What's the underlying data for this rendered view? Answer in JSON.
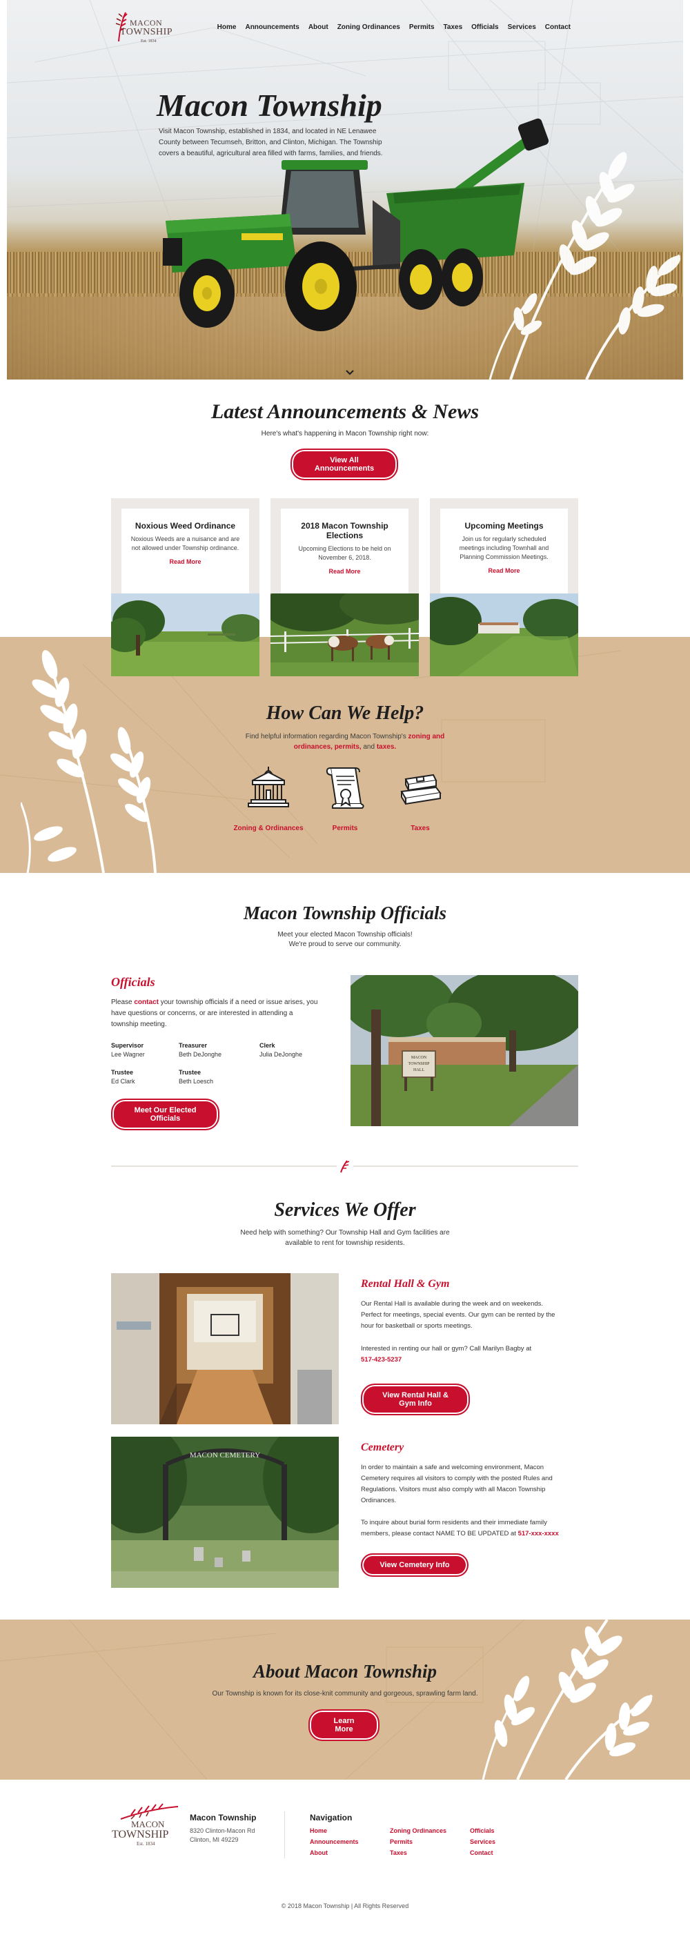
{
  "header": {
    "logo": {
      "line1": "MACON",
      "line2": "TOWNSHIP",
      "est": "Est. 1834"
    },
    "nav": [
      "Home",
      "Announcements",
      "About",
      "Zoning Ordinances",
      "Permits",
      "Taxes",
      "Officials",
      "Services",
      "Contact"
    ]
  },
  "hero": {
    "title": "Macon Township",
    "text": "Visit Macon Township, established in 1834, and located in NE Lenawee County between Tecumseh, Britton, and Clinton, Michigan. The Township covers a beautiful, agricultural area filled with farms, families, and friends."
  },
  "announcements": {
    "title": "Latest Announcements & News",
    "subtitle": "Here's what's happening in Macon Township right now:",
    "button": "View All Announcements",
    "cards": [
      {
        "title": "Noxious Weed Ordinance",
        "text": "Noxious Weeds are a nuisance and are not allowed under Township ordinance.",
        "link": "Read More"
      },
      {
        "title": "2018 Macon Township Elections",
        "text": "Upcoming Elections to be held on November 6, 2018.",
        "link": "Read More"
      },
      {
        "title": "Upcoming Meetings",
        "text": "Join us for regularly scheduled meetings including Townhall and Planning Commission Meetings.",
        "link": "Read More"
      }
    ]
  },
  "help": {
    "title": "How Can We Help?",
    "text_prefix": "Find helpful information regarding Macon Township's",
    "text_links": "zoning and ordinances, permits,",
    "text_and": "and",
    "text_taxes": "taxes.",
    "items": [
      {
        "label": "Zoning & Ordinances",
        "icon": "courthouse-icon"
      },
      {
        "label": "Permits",
        "icon": "scroll-certificate-icon"
      },
      {
        "label": "Taxes",
        "icon": "ledger-books-icon"
      }
    ]
  },
  "officials": {
    "title": "Macon Township Officials",
    "subtitle": "Meet your elected Macon Township officials! We're proud to serve our community.",
    "heading": "Officials",
    "text_before": "Please",
    "text_link": "contact",
    "text_after": "your township officials if a need or issue arises, you have questions or concerns, or are interested in attending a township meeting.",
    "people": [
      {
        "role": "Supervisor",
        "name": "Lee Wagner"
      },
      {
        "role": "Treasurer",
        "name": "Beth DeJonghe"
      },
      {
        "role": "Clerk",
        "name": "Julia DeJonghe"
      },
      {
        "role": "Trustee",
        "name": "Ed Clark"
      },
      {
        "role": "Trustee",
        "name": "Beth Loesch"
      }
    ],
    "button": "Meet Our Elected Officials",
    "sign_line1": "MACON",
    "sign_line2": "TOWNSHIP",
    "sign_line3": "HALL"
  },
  "services": {
    "title": "Services We Offer",
    "subtitle": "Need help with something? Our Township Hall and Gym facilities are available to rent for township residents.",
    "hall": {
      "heading": "Rental Hall & Gym",
      "text1": "Our Rental Hall is available during the week and on weekends. Perfect for meetings, special events. Our gym can be rented by the hour for basketball or sports meetings.",
      "text2": "Interested in renting our hall or gym? Call Marilyn Bagby at",
      "phone": "517-423-5237",
      "button": "View Rental Hall & Gym Info"
    },
    "cemetery": {
      "heading": "Cemetery",
      "text1": "In order to maintain a safe and welcoming environment, Macon Cemetery requires all visitors to comply with the posted Rules and Regulations. Visitors must also comply with all Macon Township Ordinances.",
      "text2": "To inquire about burial form residents and their immediate family members, please contact NAME TO BE UPDATED at",
      "phone": "517-xxx-xxxx",
      "button": "View Cemetery Info",
      "arch_text": "MACON CEMETERY"
    }
  },
  "about": {
    "title": "About Macon Township",
    "text": "Our Township is known for its close-knit community and gorgeous, sprawling farm land.",
    "button": "Learn More"
  },
  "footer": {
    "logo": {
      "line1": "MACON",
      "line2": "TOWNSHIP",
      "est": "Est. 1834"
    },
    "name": "Macon Township",
    "address1": "8320 Clinton-Macon Rd",
    "address2": "Clinton, MI 49229",
    "nav_heading": "Navigation",
    "links": [
      "Home",
      "Announcements",
      "About",
      "Zoning Ordinances",
      "Permits",
      "Taxes",
      "Officials",
      "Services",
      "Contact"
    ],
    "copyright": "© 2018 Macon Township | All Rights Reserved"
  },
  "colors": {
    "accent": "#c8102e",
    "tan": "#d8bb96",
    "card": "#ece9e6"
  }
}
